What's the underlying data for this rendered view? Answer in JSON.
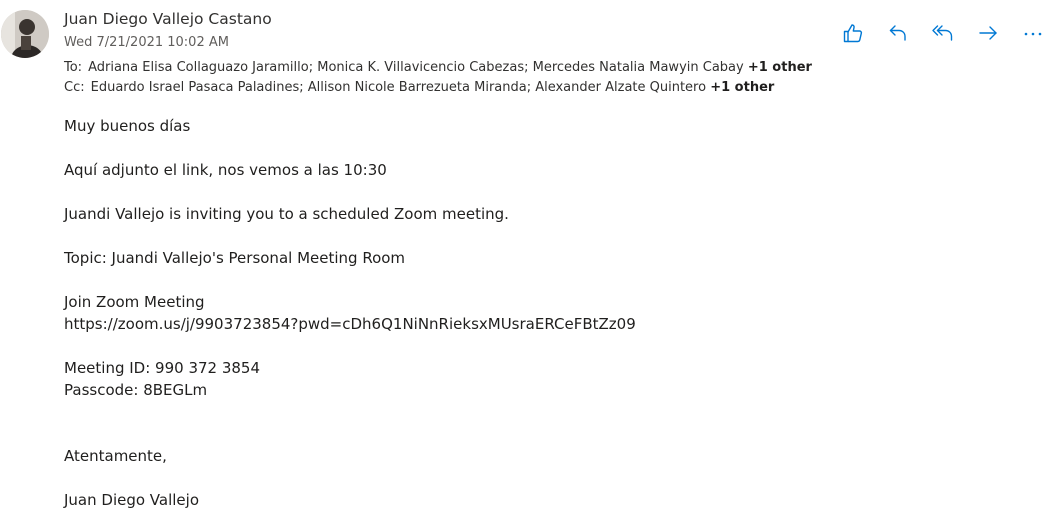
{
  "email": {
    "sender": "Juan Diego Vallejo Castano",
    "date": "Wed 7/21/2021 10:02 AM",
    "to_label": "To:",
    "to_list": "Adriana Elisa Collaguazo Jaramillo; Monica K. Villavicencio Cabezas; Mercedes Natalia Mawyin Cabay",
    "to_more": "+1 other",
    "cc_label": "Cc:",
    "cc_list": "Eduardo Israel Pasaca Paladines; Allison Nicole Barrezueta Miranda; Alexander Alzate Quintero",
    "cc_more": "+1 other"
  },
  "actions": {
    "like_icon": "thumbs-up-icon",
    "reply_icon": "reply-icon",
    "reply_all_icon": "reply-all-icon",
    "forward_icon": "forward-icon",
    "more_icon": "more-options-icon",
    "accent": "#0078d4"
  },
  "body": {
    "greeting": "Muy buenos días",
    "line1": "Aquí adjunto el link, nos vemos a las 10:30",
    "invite": "Juandi Vallejo is inviting you to a scheduled Zoom meeting.",
    "topic": "Topic: Juandi Vallejo's Personal Meeting Room",
    "join_label": "Join Zoom Meeting",
    "join_link": "https://zoom.us/j/9903723854?pwd=cDh6Q1NiNnRieksxMUsraERCeFBtZz09",
    "meeting_id": "Meeting ID: 990 372 3854",
    "passcode": "Passcode: 8BEGLm",
    "closing": "Atentamente,",
    "signature": "Juan Diego Vallejo"
  }
}
